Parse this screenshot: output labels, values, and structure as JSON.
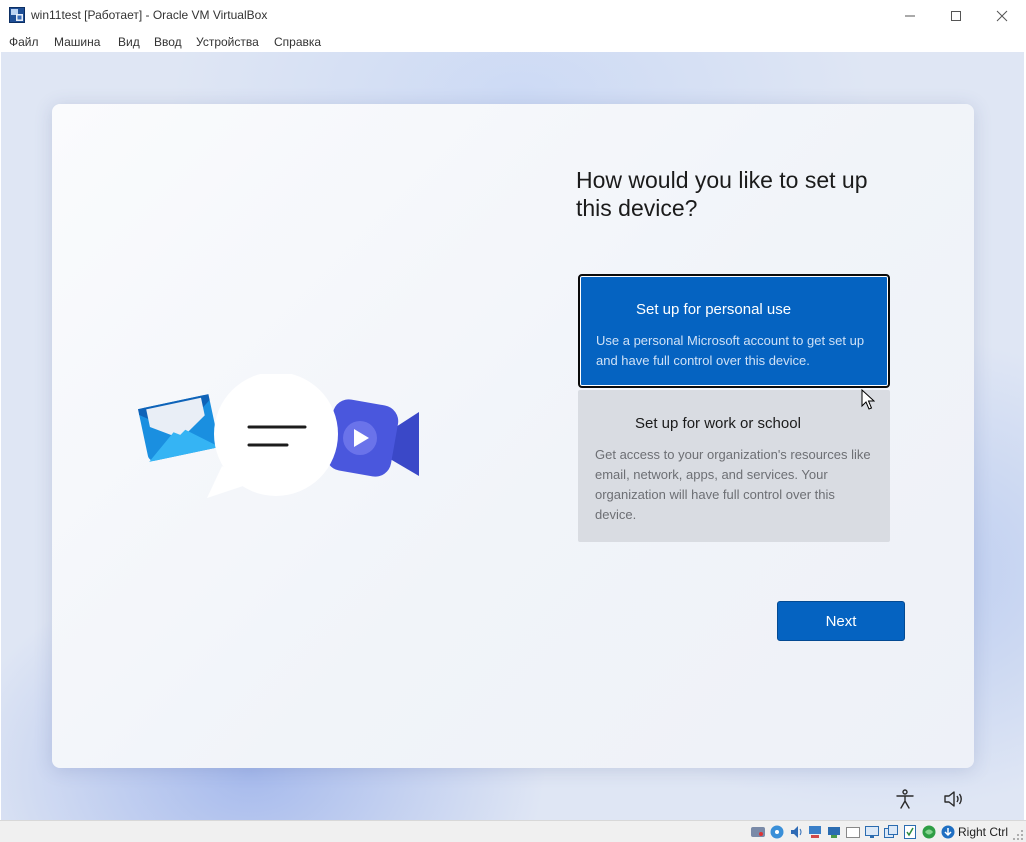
{
  "window": {
    "title": "win11test [Работает] - Oracle VM VirtualBox",
    "app_icon": "virtualbox-icon",
    "controls": [
      "minimize-icon",
      "maximize-icon",
      "close-icon"
    ]
  },
  "menu": {
    "items": [
      "Файл",
      "Машина",
      "Вид",
      "Ввод",
      "Устройства",
      "Справка"
    ]
  },
  "oobe": {
    "heading": "How would you like to set up this device?",
    "options": [
      {
        "title": "Set up for personal use",
        "description": "Use a personal Microsoft account to get set up and have full control over this device.",
        "selected": true
      },
      {
        "title": "Set up for work or school",
        "description": "Get access to your organization's resources like email, network, apps, and services. Your organization will have full control over this device.",
        "selected": false
      }
    ],
    "next_label": "Next",
    "accent_color": "#0563c1",
    "illustration_icons": [
      "mail-icon",
      "chat-bubble-icon",
      "video-call-icon"
    ],
    "footer_icons": [
      "accessibility-icon",
      "volume-icon"
    ]
  },
  "statusbar": {
    "icons": [
      "hard-disk-icon",
      "optical-drive-icon",
      "audio-icon",
      "network-icon",
      "usb-icon",
      "shared-folder-icon",
      "display-icon",
      "video-capture-icon",
      "recording-icon",
      "mouse-integration-icon",
      "keyboard-capture-icon"
    ],
    "host_key": "Right Ctrl"
  }
}
